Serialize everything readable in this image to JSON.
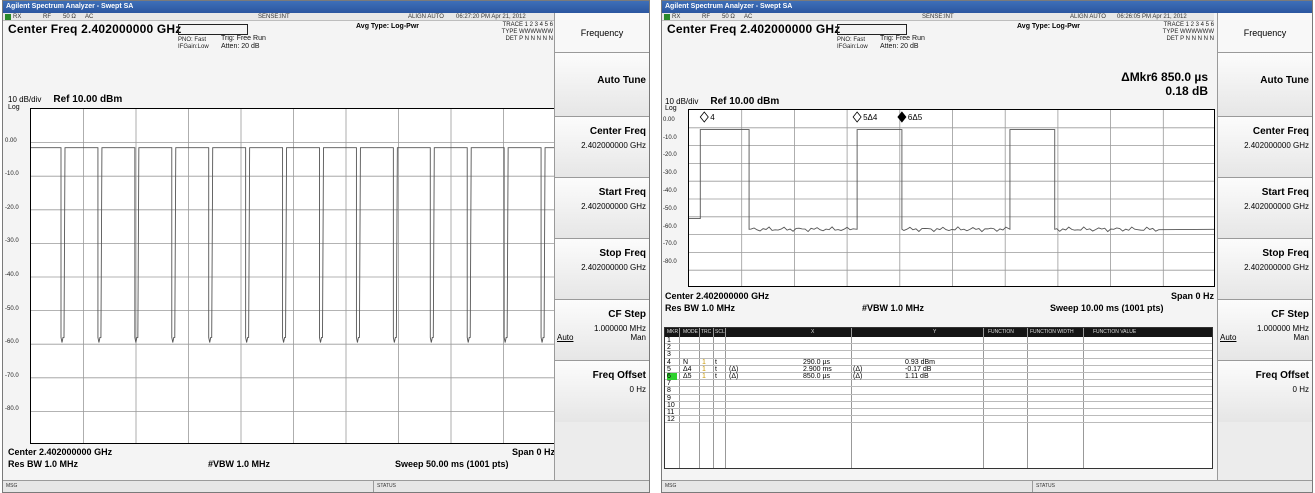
{
  "colors": {
    "title_bar": "#2b56a0",
    "trace": "#555555",
    "active_marker_row": "#2ed12e",
    "trace_index": "#c89800"
  },
  "left": {
    "window_title": "Agilent Spectrum Analyzer - Swept SA",
    "status": {
      "rx": "RX",
      "rf": "RF",
      "ohm": "50 Ω",
      "ac": "AC",
      "sense": "SENSE:INT",
      "align": "ALIGN AUTO",
      "time": "06:27:20 PM Apr 21, 2012"
    },
    "center_freq_title": "Center Freq  2.402000000 GHz",
    "pno": "PNO: Fast",
    "if_gain": "IFGain:Low",
    "trig": "Trig: Free Run",
    "atten": "Atten: 20 dB",
    "avg_type": "Avg Type: Log-Pwr",
    "trace_info": {
      "trace": "TRACE 1 2 3 4 5 6",
      "type": "TYPE WWWWWW",
      "det": "DET P N N N N N"
    },
    "scale": "10 dB/div",
    "ref": "Ref 10.00 dBm",
    "log": "Log",
    "y_labels": [
      "0.00",
      "-10.0",
      "-20.0",
      "-30.0",
      "-40.0",
      "-50.0",
      "-60.0",
      "-70.0",
      "-80.0"
    ],
    "bottom": {
      "center": "Center 2.402000000 GHz",
      "span": "Span 0 Hz",
      "rbw": "Res BW 1.0 MHz",
      "vbw": "#VBW 1.0 MHz",
      "sweep": "Sweep  50.00 ms (1001 pts)"
    },
    "msg": "MSG",
    "status_label": "STATUS",
    "trace_data": {
      "pulse_count": 14,
      "top_level_dbm": -1.5,
      "floor_level_dbm": -58,
      "floor_dip_dbm": -59.5
    }
  },
  "right": {
    "window_title": "Agilent Spectrum Analyzer - Swept SA",
    "status": {
      "rx": "RX",
      "rf": "RF",
      "ohm": "50 Ω",
      "ac": "AC",
      "sense": "SENSE:INT",
      "align": "ALIGN AUTO",
      "time": "06:26:05 PM Apr 21, 2012"
    },
    "center_freq_title": "Center Freq  2.402000000 GHz",
    "pno": "PNO: Fast",
    "if_gain": "IFGain:Low",
    "trig": "Trig: Free Run",
    "atten": "Atten: 20 dB",
    "avg_type": "Avg Type: Log-Pwr",
    "trace_info": {
      "trace": "TRACE 1 2 3 4 5 6",
      "type": "TYPE WWWWWW",
      "det": "DET P N N N N N"
    },
    "marker_readout_1": "ΔMkr6 850.0 µs",
    "marker_readout_2": "0.18 dB",
    "scale": "10 dB/div",
    "ref": "Ref 10.00 dBm",
    "log": "Log",
    "y_labels": [
      "0.00",
      "-10.0",
      "-20.0",
      "-30.0",
      "-40.0",
      "-50.0",
      "-60.0",
      "-70.0",
      "-80.0"
    ],
    "marker_labels": {
      "m4": "4",
      "m5": "5Δ4",
      "m6": "6Δ5"
    },
    "bottom": {
      "center": "Center 2.402000000 GHz",
      "span": "Span 0 Hz",
      "rbw": "Res BW 1.0 MHz",
      "vbw": "#VBW 1.0 MHz",
      "sweep": "Sweep  10.00 ms (1001 pts)"
    },
    "marker_table": {
      "headers": [
        "MKR",
        "MODE",
        "TRC",
        "SCL",
        "X",
        "Y",
        "FUNCTION",
        "FUNCTION WIDTH",
        "FUNCTION VALUE"
      ],
      "rows": [
        {
          "n": "1"
        },
        {
          "n": "2"
        },
        {
          "n": "3"
        },
        {
          "n": "4",
          "mode": "N",
          "trc": "1",
          "scl": "t",
          "x": "290.0 µs",
          "y": "0.93 dBm"
        },
        {
          "n": "5",
          "mode": "Δ4",
          "trc": "1",
          "scl": "t",
          "xd": "(Δ)",
          "x": "2.900 ms",
          "yd": "(Δ)",
          "y": "-0.17 dB"
        },
        {
          "n": "6",
          "mode": "Δ5",
          "trc": "1",
          "scl": "t",
          "xd": "(Δ)",
          "x": "850.0 µs",
          "yd": "(Δ)",
          "y": "1.11 dB",
          "active": true
        },
        {
          "n": "7"
        },
        {
          "n": "8"
        },
        {
          "n": "9"
        },
        {
          "n": "10"
        },
        {
          "n": "11"
        },
        {
          "n": "12"
        }
      ]
    },
    "msg": "MSG",
    "status_label": "STATUS",
    "trace_data": {
      "pulse_top_dbm": -1.0,
      "gap_floor_dbm": -57,
      "pulse_width_us": 850,
      "period_ms": 2.9,
      "first_pulse_start_us": 290
    }
  },
  "softkeys": {
    "menu_title": "Frequency",
    "auto_tune": "Auto Tune",
    "center_freq": "Center Freq",
    "center_freq_value": "2.402000000 GHz",
    "start_freq": "Start Freq",
    "start_freq_value": "2.402000000 GHz",
    "stop_freq": "Stop Freq",
    "stop_freq_value": "2.402000000 GHz",
    "cf_step": "CF Step",
    "cf_step_value": "1.000000 MHz",
    "auto": "Auto",
    "man": "Man",
    "freq_offset": "Freq Offset",
    "freq_offset_value": "0 Hz"
  }
}
